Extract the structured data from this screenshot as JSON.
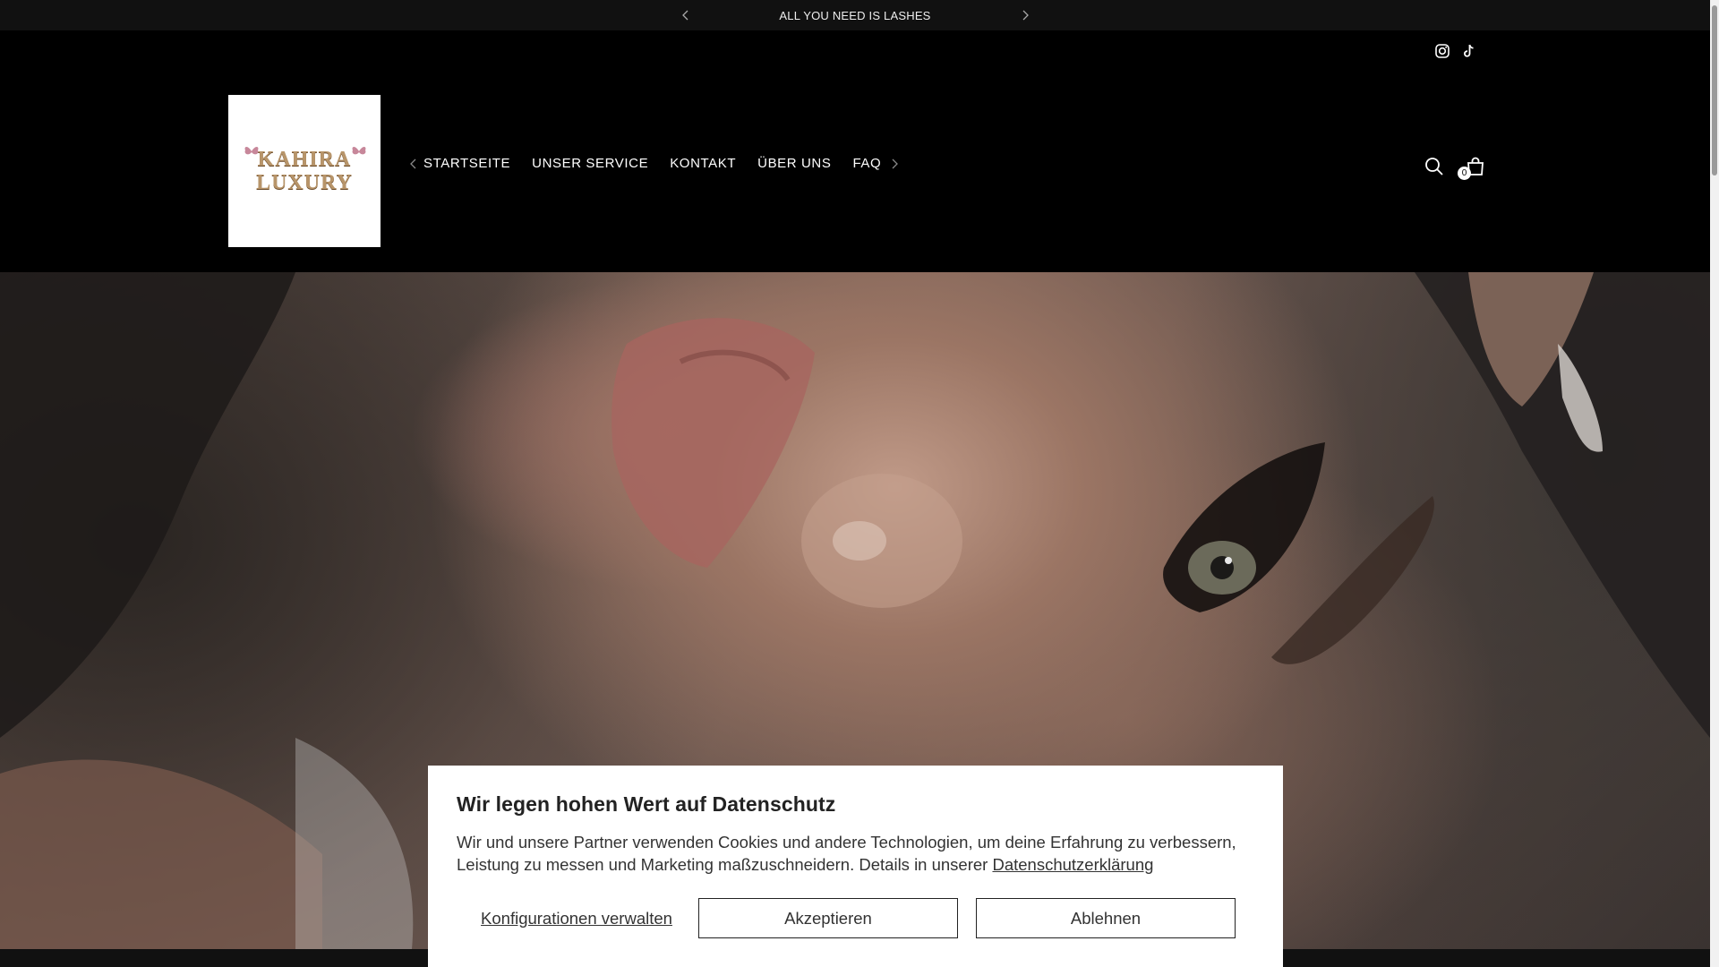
{
  "announcement": {
    "text": "ALL YOU NEED IS LASHES",
    "prev_icon": "chevron-left-icon",
    "next_icon": "chevron-right-icon"
  },
  "header": {
    "social": [
      "instagram-icon",
      "tiktok-icon"
    ],
    "logo": {
      "line1": "KAHIRA",
      "line2": "LUXURY"
    },
    "nav": [
      {
        "label": "STARTSEITE"
      },
      {
        "label": "UNSER SERVICE"
      },
      {
        "label": "KONTAKT"
      },
      {
        "label": "ÜBER UNS"
      },
      {
        "label": "FAQ"
      }
    ],
    "cart_count": "0",
    "colors": {
      "background": "#000000",
      "text": "#ffffff",
      "logo_gold": "#b8956a"
    }
  },
  "cookie": {
    "title": "Wir legen hohen Wert auf Datenschutz",
    "body": "Wir und unsere Partner verwenden Cookies und andere Technologien, um deine Erfahrung zu verbessern, Leistung zu messen und Marketing maßzuschneidern. Details in unserer ",
    "privacy_link": "Datenschutzerklärung",
    "manage_label": "Konfigurationen verwalten",
    "accept_label": "Akzeptieren",
    "decline_label": "Ablehnen"
  }
}
